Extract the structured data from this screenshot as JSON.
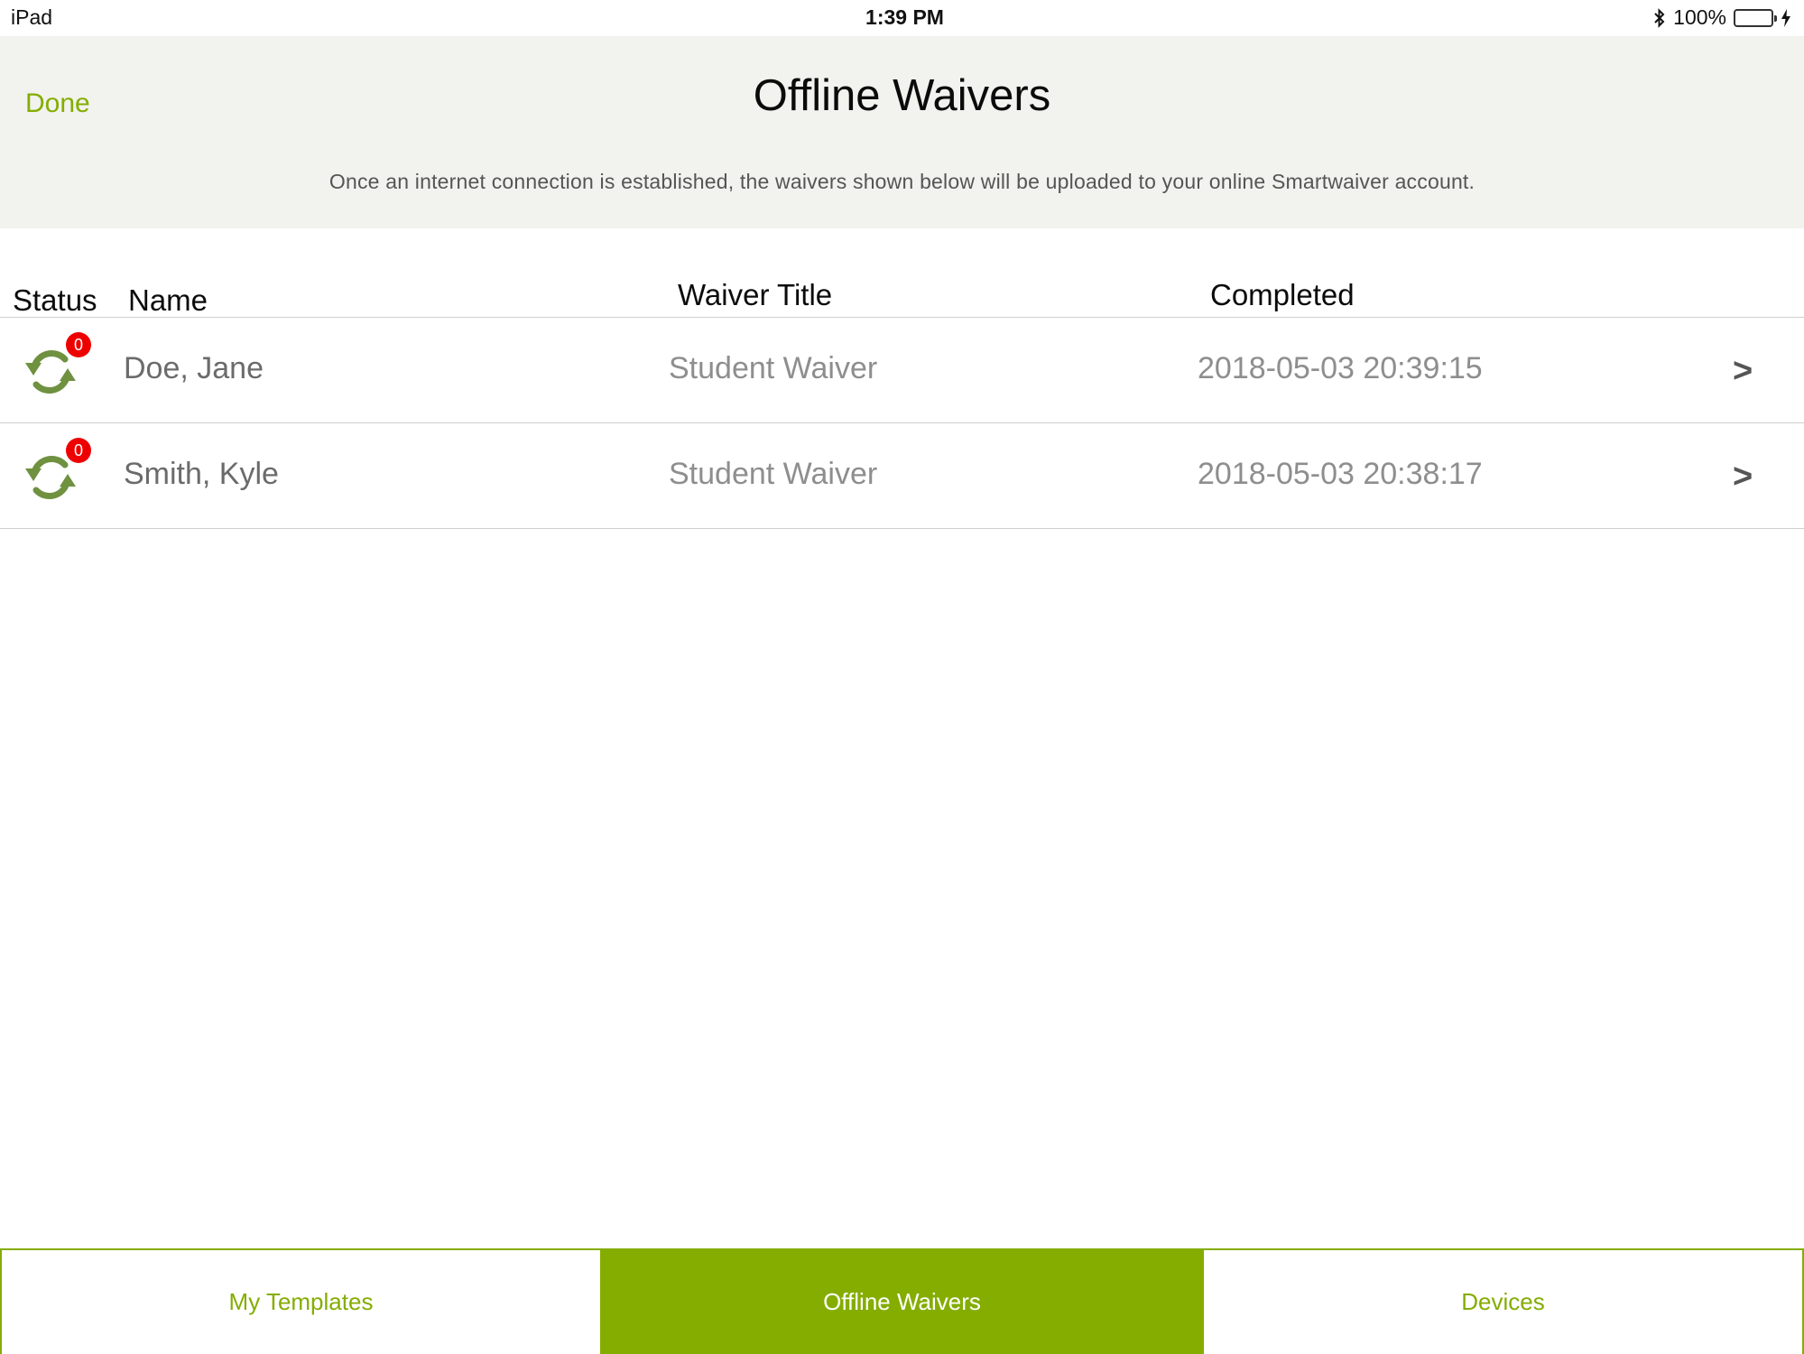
{
  "status_bar": {
    "device": "iPad",
    "time": "1:39 PM",
    "battery": "100%"
  },
  "header": {
    "done_label": "Done",
    "title": "Offline Waivers",
    "subtitle": "Once an internet connection is established, the waivers shown below will be uploaded to your online Smartwaiver account."
  },
  "table": {
    "columns": {
      "status": "Status",
      "name": "Name",
      "waiver_title": "Waiver Title",
      "completed": "Completed"
    },
    "rows": [
      {
        "badge": "0",
        "name": "Doe, Jane",
        "waiver_title": "Student Waiver",
        "completed": "2018-05-03 20:39:15",
        "chevron": ">"
      },
      {
        "badge": "0",
        "name": "Smith, Kyle",
        "waiver_title": "Student Waiver",
        "completed": "2018-05-03 20:38:17",
        "chevron": ">"
      }
    ]
  },
  "tabs": [
    {
      "label": "My Templates",
      "active": false
    },
    {
      "label": "Offline Waivers",
      "active": true
    },
    {
      "label": "Devices",
      "active": false
    }
  ],
  "icons": {
    "sync": "sync-icon",
    "bluetooth": "bluetooth-icon",
    "battery": "battery-icon",
    "charging": "charging-icon"
  },
  "colors": {
    "accent": "#84ad00",
    "header_bg": "#f2f2ee",
    "sync_icon": "#6f9140",
    "badge": "#ee0000"
  }
}
